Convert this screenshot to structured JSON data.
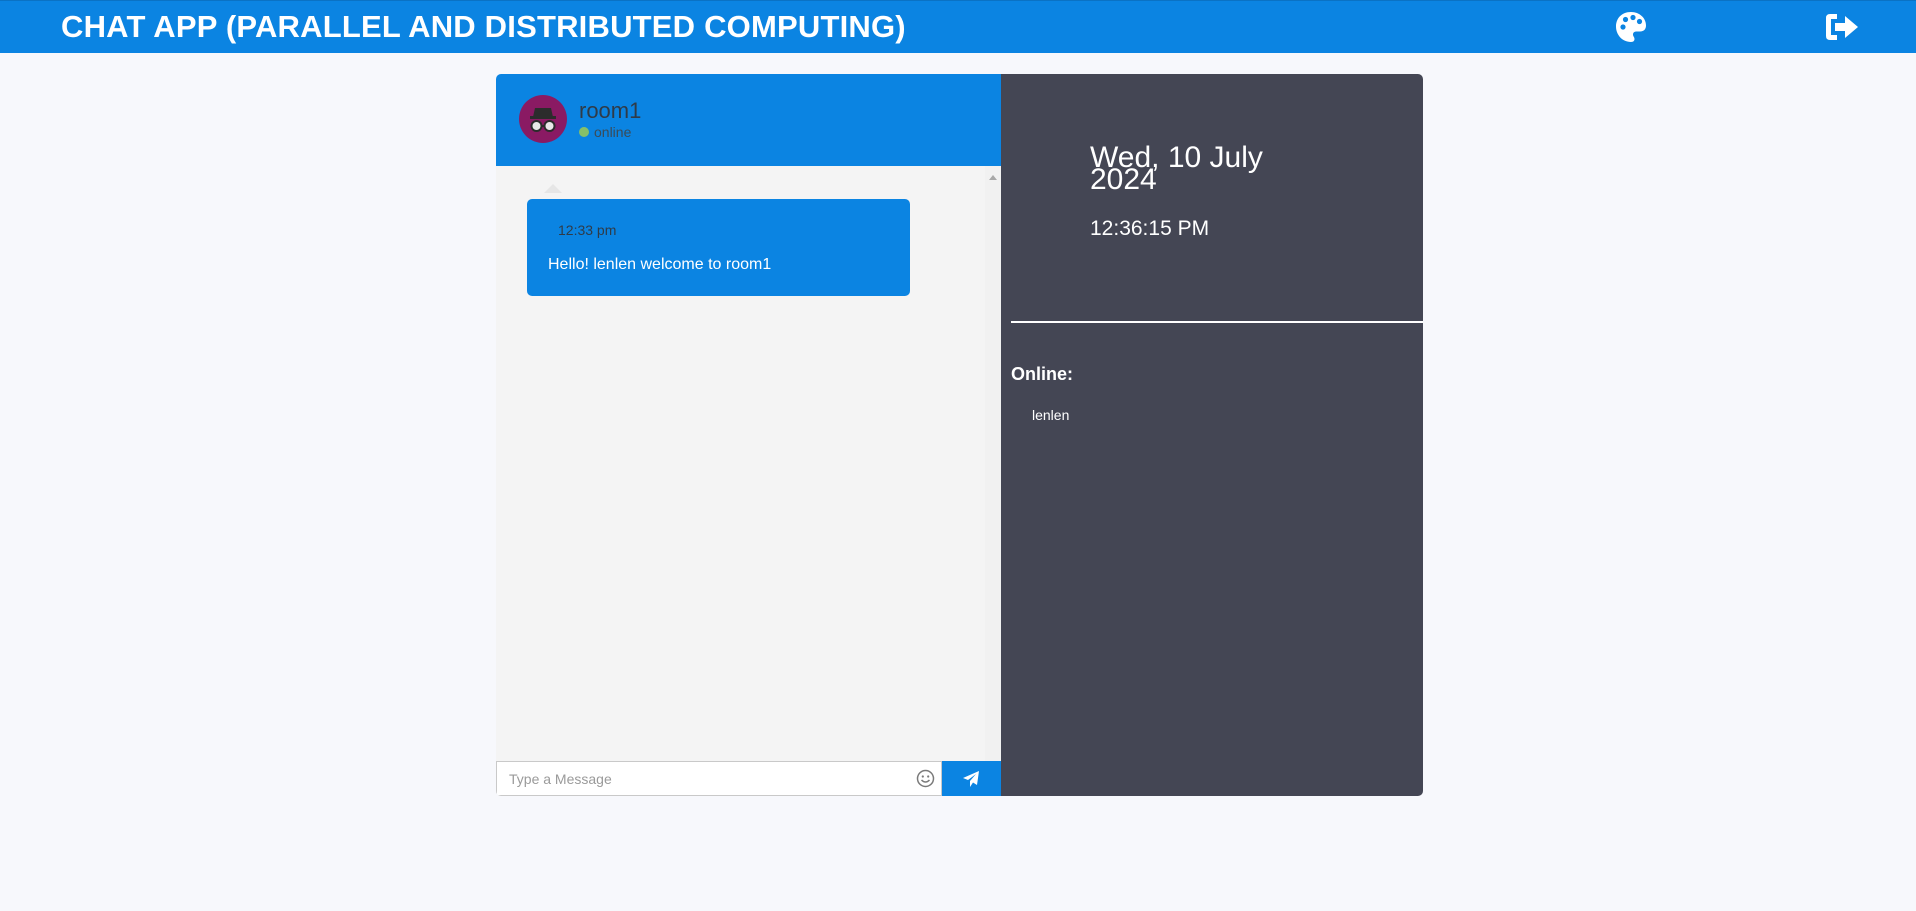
{
  "header": {
    "title": "CHAT APP (PARALLEL AND DISTRIBUTED COMPUTING)",
    "palette_icon": "palette-icon",
    "logout_icon": "sign-out-icon"
  },
  "chat": {
    "room_name": "room1",
    "status": "online",
    "avatar_icon": "incognito-icon",
    "messages": [
      {
        "time": "12:33 pm",
        "text": "Hello! lenlen welcome to room1"
      }
    ],
    "input": {
      "value": "",
      "placeholder": "Type a Message"
    },
    "emoji_icon": "smile-icon",
    "send_icon": "paper-plane-icon"
  },
  "sidebar": {
    "date": "Wed, 10 July 2024",
    "time": "12:36:15 PM",
    "online_label": "Online:",
    "online_users": [
      "lenlen"
    ]
  },
  "colors": {
    "primary": "#0b84e2",
    "sidebar_bg": "#444654",
    "page_bg": "#f7f8fc",
    "chat_bg": "#f4f4f4",
    "avatar_bg": "#8a1a63",
    "online_dot": "#86c06a"
  }
}
